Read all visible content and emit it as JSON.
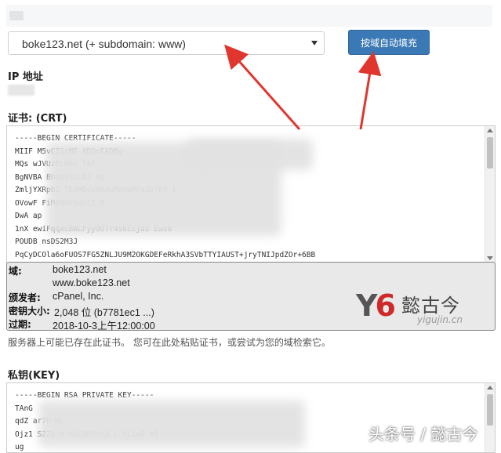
{
  "domain_select": {
    "selected": "boke123.net   (+ subdomain: www)"
  },
  "autofill_button": {
    "label": "按域自动填充"
  },
  "ip_section": {
    "label": "IP 地址"
  },
  "crt_section": {
    "label": "证书: (CRT)",
    "lines": [
      "-----BEGIN CERTIFICATE-----",
      "MIIF                        M5vCISzMF                 ADQ=FADBy",
      "MQs                    wJVUzELMAk                         TAT",
      "BgNVBA                              BhbmVsLCBJ              Ap",
      "ZmljYXRpb2                     TE4MDcwNDAwMDAwMFoXDTE4          1",
      "OVowF                                    FiMA0GCSqGSI           B",
      "DwA                                                            ap",
      "1nX              ewiFqqxcBWLFyy9O7r4s6ccjdz                Ews6",
      "POUDB                                                  nsDS2M3J",
      "PqCyDCOla6oFUOS7FG5ZNLJU9M2OKGDEFeRkhA3SVbTTYIAUST+jryTNIJpdZOr+6BB"
    ]
  },
  "cert_info": {
    "domain_key": "域:",
    "domain_values": [
      "boke123.net",
      "www.boke123.net"
    ],
    "issuer_key": "颁发者:",
    "issuer_value": "cPanel, Inc.",
    "keysize_key": "密钥大小:",
    "keysize_value": "2,048 位 (b7781ec1 ...)",
    "expires_key": "过期:",
    "expires_value": "2018-10-3上午12:00:00"
  },
  "watermark": {
    "yg": "Y6",
    "cn": "懿古今",
    "url": "yigujin.cn",
    "bottom": "头条号 / 懿古今"
  },
  "help_text": "服务器上可能已存在此证书。 您可在此处粘贴证书，或尝试为您的域检索它。",
  "key_section": {
    "label": "私钥(KEY)",
    "lines": [
      "-----BEGIN RSA PRIVATE KEY-----",
      "                                                          TAnG",
      "qdZ                                              ar7h       ML",
      "Ojz1                    SZZy  h    h0iQDYch3  L    SLlvO      h9",
      "                                                        ug"
    ]
  },
  "colors": {
    "button": "#3b79b6",
    "arrow": "#e0362f",
    "info_box": "#e9e9e9"
  }
}
